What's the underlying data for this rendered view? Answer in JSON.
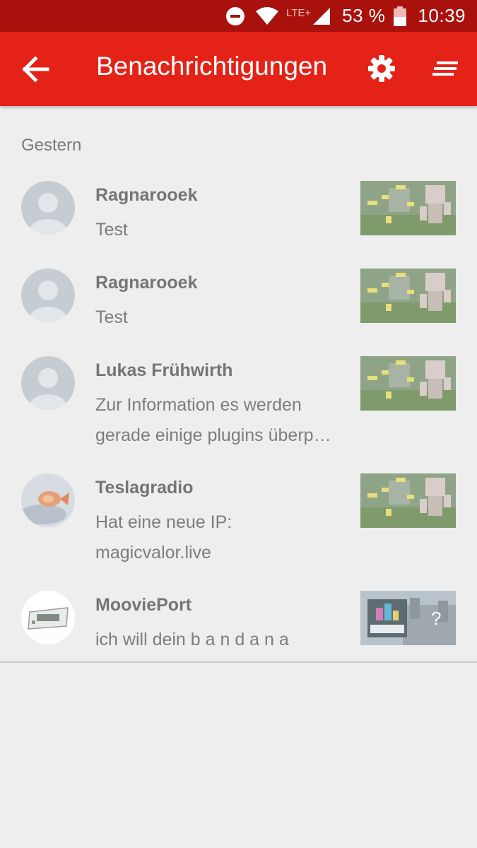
{
  "status_bar": {
    "network": "LTE+",
    "battery": "53 %",
    "time": "10:39",
    "icons": [
      "do-not-disturb-icon",
      "wifi-icon",
      "cell-signal-icon",
      "battery-icon"
    ]
  },
  "app_bar": {
    "title": "Benachrichtigungen",
    "color": "#e52218",
    "icons": [
      "arrow-back-icon",
      "gear-icon",
      "sort-icon"
    ]
  },
  "section": {
    "title": "Gestern"
  },
  "notifications": [
    {
      "name": "Ragnarooek",
      "lines": [
        "Test"
      ],
      "avatar": "default-avatar-icon",
      "thumbnail": "minecraft-thumbnail"
    },
    {
      "name": "Ragnarooek",
      "lines": [
        "Test"
      ],
      "avatar": "default-avatar-icon",
      "thumbnail": "minecraft-thumbnail"
    },
    {
      "name": "Lukas Frühwirth",
      "lines": [
        "Zur Information es werden",
        "gerade einige plugins überp…"
      ],
      "avatar": "default-avatar-icon",
      "thumbnail": "minecraft-thumbnail"
    },
    {
      "name": "Teslagradio",
      "lines": [
        "Hat eine neue IP:",
        "magicvalor.live"
      ],
      "avatar": "goldfish-avatar",
      "thumbnail": "minecraft-thumbnail"
    },
    {
      "name": "MooviePort",
      "lines": [
        "ich will dein b a n d a n a"
      ],
      "avatar": "logo-avatar",
      "thumbnail": "server-thumbnail"
    }
  ]
}
